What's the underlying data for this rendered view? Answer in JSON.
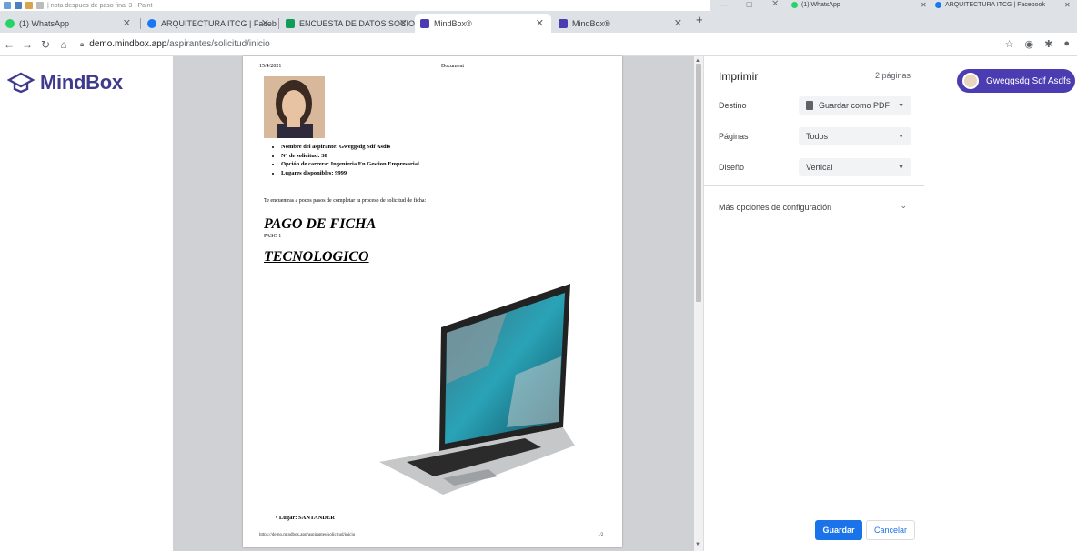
{
  "paint": {
    "title": "| nota despues de paso final 3 - Paint"
  },
  "tabs": [
    {
      "label": "(1) WhatsApp"
    },
    {
      "label": "ARQUITECTURA ITCG | Facebook"
    },
    {
      "label": "ENCUESTA DE DATOS SOCIO EC"
    },
    {
      "label": "MindBox®"
    },
    {
      "label": "MindBox®"
    }
  ],
  "tabs2": [
    {
      "label": "(1) WhatsApp"
    },
    {
      "label": "ARQUITECTURA ITCG | Facebook"
    }
  ],
  "address": {
    "host": "demo.mindbox.app",
    "path": "/aspirantes/solicitud/inicio"
  },
  "brand": {
    "name": "MindBox",
    "color": "#3f3a8c"
  },
  "user": {
    "name": "Gweggsdg Sdf Asdfs"
  },
  "document": {
    "date": "15/4/2021",
    "header": "Document",
    "bullets": [
      "Nombre del aspirante: Gweggsdg Sdf Asdfs",
      "N° de solicitud: 38",
      "Opción de carrera: Ingenieria En Gestion Empresarial",
      "Lugares disponibles: 9999"
    ],
    "intro": "Te encuentras a pocos pasos de completar tu proceso de solicitud de ficha:",
    "heading1": "PAGO DE FICHA",
    "step": "PASO 1",
    "heading2": "TECNOLOGICO",
    "place": "Lugar: SANTANDER",
    "footer_url": "https://demo.mindbox.app/aspirantes/solicitud/inicio",
    "footer_page": "1/2"
  },
  "print": {
    "title": "Imprimir",
    "page_count": "2 páginas",
    "rows": [
      {
        "label": "Destino",
        "value": "Guardar como PDF"
      },
      {
        "label": "Páginas",
        "value": "Todos"
      },
      {
        "label": "Diseño",
        "value": "Vertical"
      }
    ],
    "more": "Más opciones de configuración",
    "save": "Guardar",
    "cancel": "Cancelar",
    "accent": "#1a73e8"
  }
}
